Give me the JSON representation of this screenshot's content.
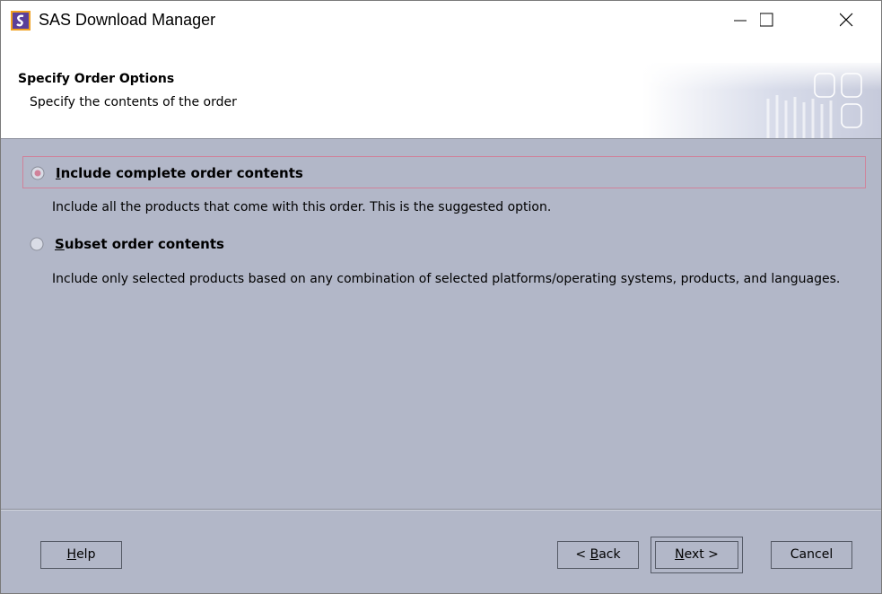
{
  "window": {
    "title": "SAS Download Manager",
    "app_icon": "sas-logo-icon",
    "controls": [
      "minimize-icon",
      "maximize-icon",
      "close-icon"
    ]
  },
  "header": {
    "title": "Specify Order Options",
    "subtitle": "Specify the contents of the order"
  },
  "options": [
    {
      "label_mnemonic": "I",
      "label_rest": "nclude complete order contents",
      "description": "Include all the products that come with this order. This is the suggested option.",
      "selected": true
    },
    {
      "label_mnemonic": "S",
      "label_rest": "ubset order contents",
      "description": "Include only selected products based on any combination of selected platforms/operating systems, products, and languages.",
      "selected": false
    }
  ],
  "buttons": {
    "help": {
      "mnemonic": "H",
      "rest": "elp"
    },
    "back": {
      "prefix": "< ",
      "mnemonic": "B",
      "rest": "ack"
    },
    "next": {
      "mnemonic": "N",
      "rest": "ext >"
    },
    "cancel": {
      "label": "Cancel"
    }
  },
  "colors": {
    "dialog_bg": "#b2b7c8",
    "selection_border": "#d0829a",
    "radio_selected_dot": "#d0829a"
  }
}
